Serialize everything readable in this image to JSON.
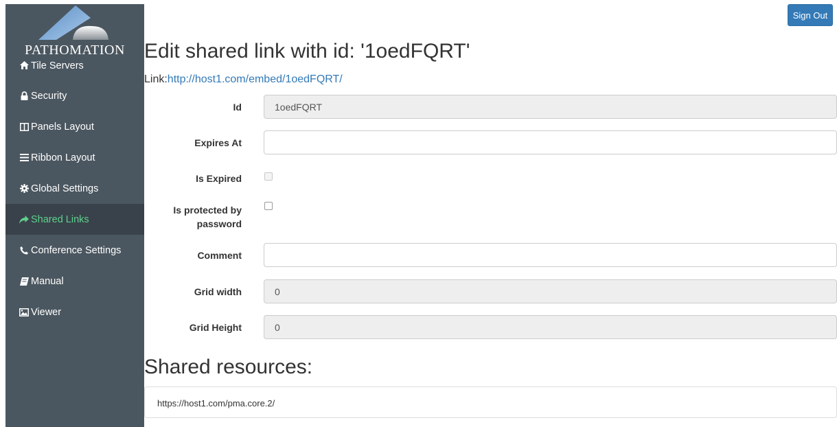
{
  "brand": {
    "name": "PATHOMATION"
  },
  "header": {
    "sign_out_label": "Sign Out"
  },
  "sidebar": {
    "items": [
      {
        "label": "Tile Servers",
        "icon": "home-icon"
      },
      {
        "label": "Security",
        "icon": "lock-icon"
      },
      {
        "label": "Panels Layout",
        "icon": "columns-icon"
      },
      {
        "label": "Ribbon Layout",
        "icon": "bars-icon"
      },
      {
        "label": "Global Settings",
        "icon": "gear-icon"
      },
      {
        "label": "Shared Links",
        "icon": "share-icon",
        "active": true
      },
      {
        "label": "Conference Settings",
        "icon": "phone-icon"
      },
      {
        "label": "Manual",
        "icon": "book-icon"
      },
      {
        "label": "Viewer",
        "icon": "image-icon"
      }
    ]
  },
  "main": {
    "title": "Edit shared link with id: '1oedFQRT'",
    "link_prefix": "Link:",
    "link_url": "http://host1.com/embed/1oedFQRT/",
    "form": {
      "id_label": "Id",
      "id_value": "1oedFQRT",
      "expires_label": "Expires At",
      "expires_value": "",
      "is_expired_label": "Is Expired",
      "is_expired_checked": false,
      "protected_label_line1": "Is protected by",
      "protected_label_line2": "password",
      "protected_checked": false,
      "comment_label": "Comment",
      "comment_value": "",
      "grid_width_label": "Grid width",
      "grid_width_value": "0",
      "grid_height_label": "Grid Height",
      "grid_height_value": "0"
    },
    "shared_resources_title": "Shared resources:",
    "shared_resources": [
      "https://host1.com/pma.core.2/"
    ]
  },
  "colors": {
    "sidebar_bg": "#4b5760",
    "sidebar_active_bg": "#39424a",
    "active_text": "#5fd08e",
    "primary": "#337ab7"
  }
}
